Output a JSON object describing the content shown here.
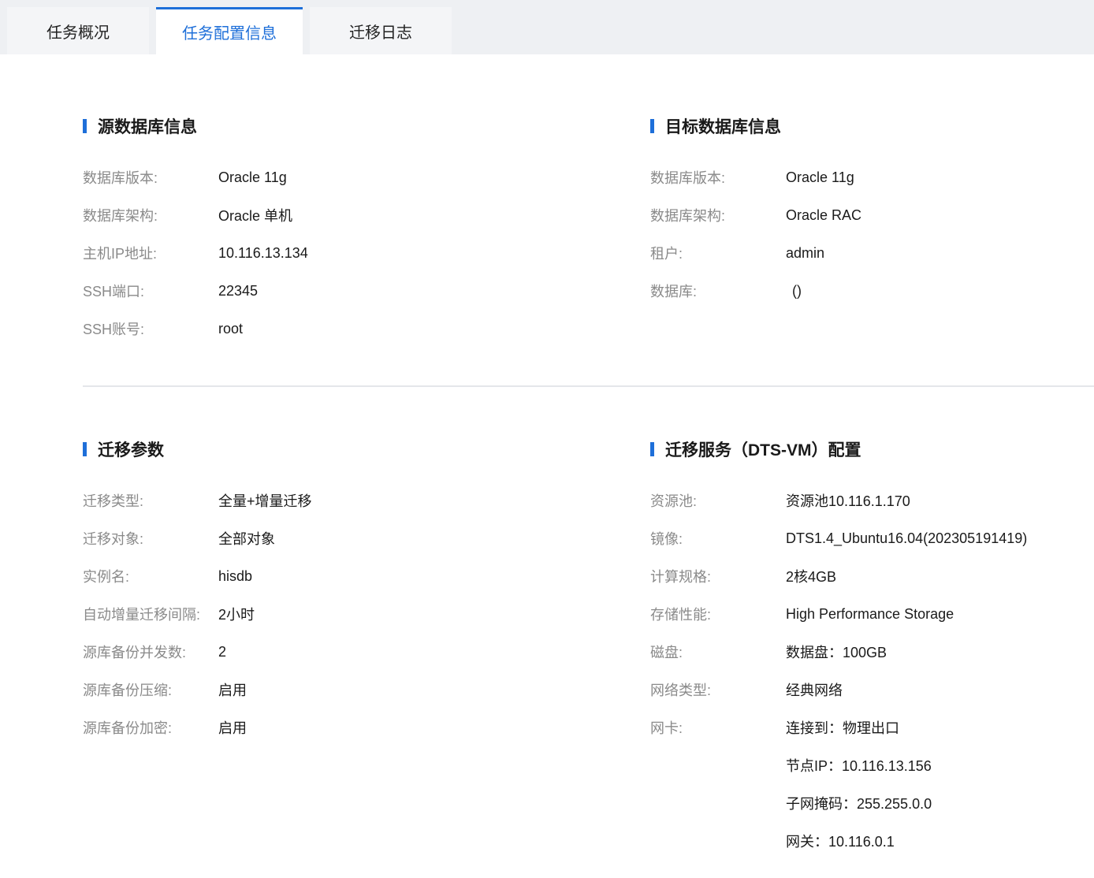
{
  "tabs": [
    {
      "label": "任务概况"
    },
    {
      "label": "任务配置信息"
    },
    {
      "label": "迁移日志"
    }
  ],
  "source": {
    "title": "源数据库信息",
    "rows": [
      {
        "label": "数据库版本:",
        "value": "Oracle 11g"
      },
      {
        "label": "数据库架构:",
        "value": "Oracle 单机"
      },
      {
        "label": "主机IP地址:",
        "value": "10.116.13.134"
      },
      {
        "label": "SSH端口:",
        "value": "22345"
      },
      {
        "label": "SSH账号:",
        "value": "root"
      }
    ]
  },
  "target": {
    "title": "目标数据库信息",
    "rows": [
      {
        "label": "数据库版本:",
        "value": "Oracle 11g"
      },
      {
        "label": "数据库架构:",
        "value": "Oracle RAC"
      },
      {
        "label": "租户:",
        "value": "admin"
      },
      {
        "label": "数据库:",
        "value": "()"
      }
    ]
  },
  "migration": {
    "title": "迁移参数",
    "rows": [
      {
        "label": "迁移类型:",
        "value": "全量+增量迁移"
      },
      {
        "label": "迁移对象:",
        "value": "全部对象"
      },
      {
        "label": "实例名:",
        "value": "hisdb"
      },
      {
        "label": "自动增量迁移间隔:",
        "value": "2小时"
      },
      {
        "label": "源库备份并发数:",
        "value": "2"
      },
      {
        "label": "源库备份压缩:",
        "value": "启用"
      },
      {
        "label": "源库备份加密:",
        "value": "启用"
      }
    ]
  },
  "service": {
    "title": "迁移服务（DTS-VM）配置",
    "rows": [
      {
        "label": "资源池:",
        "value": "资源池10.116.1.170"
      },
      {
        "label": "镜像:",
        "value": "DTS1.4_Ubuntu16.04(202305191419)"
      },
      {
        "label": "计算规格:",
        "value": "2核4GB"
      },
      {
        "label": "存储性能:",
        "value": "High Performance Storage"
      },
      {
        "label": "磁盘:",
        "value": "数据盘：100GB"
      },
      {
        "label": "网络类型:",
        "value": "经典网络"
      },
      {
        "label": "网卡:",
        "value": "连接到：物理出口"
      },
      {
        "label": "",
        "value": "节点IP：10.116.13.156"
      },
      {
        "label": "",
        "value": "子网掩码：255.255.0.0"
      },
      {
        "label": "",
        "value": "网关：10.116.0.1"
      }
    ]
  }
}
